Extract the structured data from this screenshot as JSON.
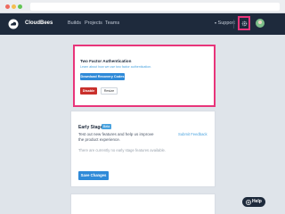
{
  "nav": {
    "brand": "CloudBees",
    "links": [
      "Builds",
      "Projects",
      "Teams"
    ],
    "support_label": "Support",
    "support_chevron": "▾",
    "icons": [
      "cloudbees-logo-icon",
      "gear-icon",
      "avatar"
    ]
  },
  "two_factor": {
    "title": "Two Factor Authentication",
    "link": "Learn about how we use two factor authentication.",
    "recovery_button": "Download Recovery Codes",
    "disable_button": "Disable",
    "resize_button": "Resize"
  },
  "early_stage": {
    "title": "Early Stage",
    "badge": "Beta",
    "description": "Test out new features and help us improve the product experience.",
    "submit_link": "Submit Feedback",
    "empty_text": "There are currently no early stage features available.",
    "save_button": "Save Changes"
  },
  "help": {
    "label": "Help",
    "icon": "help-circle-icon"
  },
  "colors": {
    "nav_bg": "#1e2a3c",
    "accent": "#2f8ad8",
    "danger": "#c9302c",
    "highlight": "#e8357a"
  }
}
